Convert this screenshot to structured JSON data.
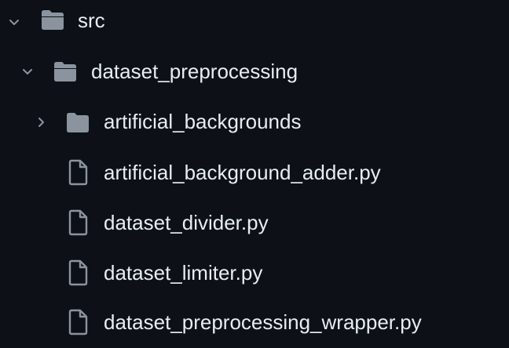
{
  "tree": {
    "root": {
      "label": "src",
      "state": "expanded",
      "icon": "folder-open-icon"
    },
    "sub": {
      "label": "dataset_preprocessing",
      "state": "expanded",
      "icon": "folder-open-icon"
    },
    "folder": {
      "label": "artificial_backgrounds",
      "state": "collapsed",
      "icon": "folder-icon"
    },
    "files": [
      {
        "label": "artificial_background_adder.py",
        "icon": "file-icon"
      },
      {
        "label": "dataset_divider.py",
        "icon": "file-icon"
      },
      {
        "label": "dataset_limiter.py",
        "icon": "file-icon"
      },
      {
        "label": "dataset_preprocessing_wrapper.py",
        "icon": "file-icon"
      }
    ]
  },
  "colors": {
    "background": "#0d1117",
    "text": "#e6edf3",
    "icon": "#8b949e"
  }
}
